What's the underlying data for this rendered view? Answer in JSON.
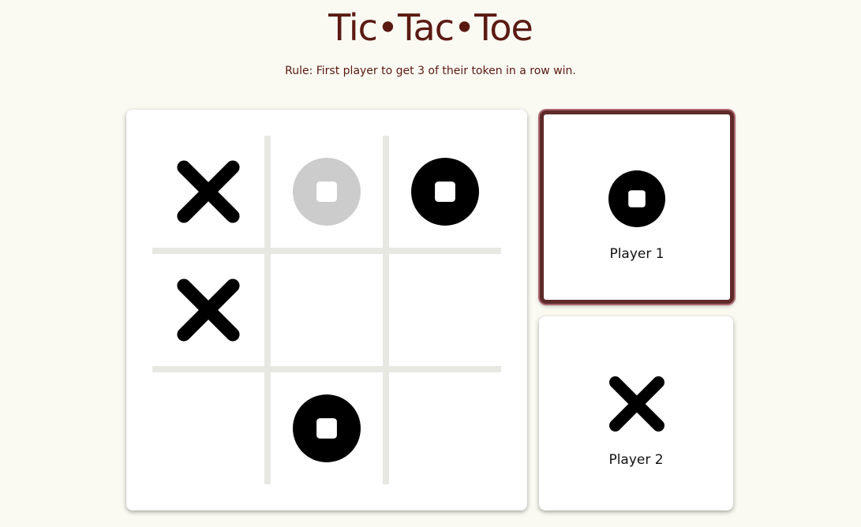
{
  "header": {
    "title": "Tic•Tac•Toe",
    "rule": "Rule: First player to get 3 of their token in a row win."
  },
  "board": {
    "cells": [
      {
        "row": 1,
        "col": 1,
        "token": "x",
        "state": "placed"
      },
      {
        "row": 1,
        "col": 2,
        "token": "o",
        "state": "preview"
      },
      {
        "row": 1,
        "col": 3,
        "token": "o",
        "state": "placed"
      },
      {
        "row": 2,
        "col": 1,
        "token": "x",
        "state": "placed"
      },
      {
        "row": 2,
        "col": 2,
        "token": "",
        "state": "empty"
      },
      {
        "row": 2,
        "col": 3,
        "token": "",
        "state": "empty"
      },
      {
        "row": 3,
        "col": 1,
        "token": "",
        "state": "empty"
      },
      {
        "row": 3,
        "col": 2,
        "token": "o",
        "state": "placed"
      },
      {
        "row": 3,
        "col": 3,
        "token": "",
        "state": "empty"
      }
    ]
  },
  "players": [
    {
      "label": "Player 1",
      "token": "o",
      "active": true
    },
    {
      "label": "Player 2",
      "token": "x",
      "active": false
    }
  ],
  "colors": {
    "title": "#5a1a12",
    "background": "#fafaf3",
    "token": "#000000",
    "preview_token": "#cccccc",
    "grid_line": "#e8e8e3",
    "active_border": "#5e2a2a"
  }
}
